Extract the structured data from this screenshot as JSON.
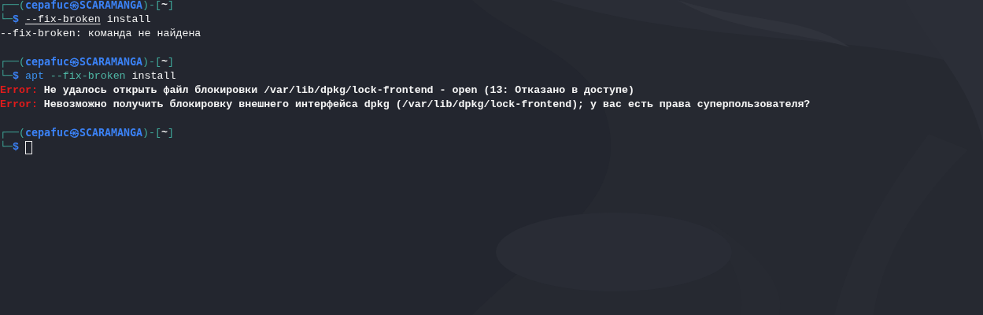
{
  "terminal": {
    "lines": [
      {
        "kind": "prompt",
        "open": "┌──(",
        "user": "cepafuc",
        "at": "㉿",
        "host": "SCARAMANGA",
        "mid": ")-[",
        "dir": "~",
        "end": "]",
        "corner": "└─",
        "dollar": "$",
        "command": [
          {
            "kind": "invalid",
            "text": "--fix-broken"
          },
          {
            "kind": "arg",
            "text": "install"
          }
        ],
        "cursor": false
      },
      {
        "kind": "output",
        "text": "--fix-broken: команда не найдена"
      },
      {
        "kind": "blank"
      },
      {
        "kind": "prompt",
        "open": "┌──(",
        "user": "cepafuc",
        "at": "㉿",
        "host": "SCARAMANGA",
        "mid": ")-[",
        "dir": "~",
        "end": "]",
        "corner": "└─",
        "dollar": "$",
        "command": [
          {
            "kind": "program",
            "text": "apt"
          },
          {
            "kind": "option",
            "text": "--fix-broken"
          },
          {
            "kind": "arg",
            "text": "install"
          }
        ],
        "cursor": false
      },
      {
        "kind": "error",
        "label": "Error:",
        "text": "Не удалось открыть файл блокировки /var/lib/dpkg/lock-frontend - open (13: Отказано в доступе)"
      },
      {
        "kind": "error",
        "label": "Error:",
        "text": "Невозможно получить блокировку внешнего интерфейса dpkg (/var/lib/dpkg/lock-frontend); у вас есть права суперпользователя?"
      },
      {
        "kind": "blank"
      },
      {
        "kind": "prompt",
        "open": "┌──(",
        "user": "cepafuc",
        "at": "㉿",
        "host": "SCARAMANGA",
        "mid": ")-[",
        "dir": "~",
        "end": "]",
        "corner": "└─",
        "dollar": "$",
        "cursor": true
      }
    ]
  }
}
